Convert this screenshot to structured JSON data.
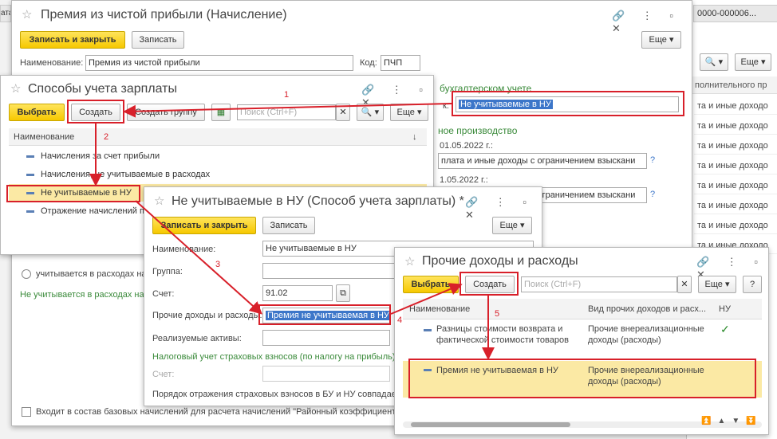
{
  "bg": {
    "tab_fragment": "ата",
    "tab_number": "0000-000006...",
    "search_btn": "🔍 ▾",
    "more_btn": "Еще ▾",
    "col_header": "полнительного пр",
    "rows": [
      "та и иные доходо",
      "та и иные доходо",
      "та и иные доходо",
      "та и иные доходо",
      "та и иные доходо",
      "та и иные доходо",
      "та и иные доходо",
      "та и иные доходо"
    ]
  },
  "main_form": {
    "title": "Премия из чистой прибыли (Начисление)",
    "save_close": "Записать и закрыть",
    "save": "Записать",
    "more": "Еще ▾",
    "name_label": "Наименование:",
    "name_value": "Премия из чистой прибыли",
    "code_label": "Код:",
    "code_value": "ПЧП",
    "accounting_heading": "бухгалтерском учете",
    "method_label": "к:",
    "method_value": "Не учитываемые в НУ",
    "production_heading": "ное производство",
    "date1": "01.05.2022 г.:",
    "payment1": "плата и иные доходы с ограничением взыскани",
    "date2": "1.05.2022 г.:",
    "payment2": "плата и иные доходы с ограничением взыскани",
    "help": "?",
    "radio1": "учитывается в расходах на",
    "link_text": "Не учитывается в расходах на",
    "checkbox_label": "Входит в состав базовых начислений для расчета начислений \"Районный коэффициент\" и"
  },
  "methods_list": {
    "title": "Способы учета зарплаты",
    "choose": "Выбрать",
    "create": "Создать",
    "create_group": "Создать группу",
    "search_placeholder": "Поиск (Ctrl+F)",
    "more": "Еще ▾",
    "col_name": "Наименование",
    "sort_icon": "↓",
    "items": [
      "Начисления за счет прибыли",
      "Начисления, не учитываемые в расходах",
      "Не учитываемые в НУ",
      "Отражение начислений п"
    ]
  },
  "method_form": {
    "title": "Не учитываемые в НУ (Способ учета зарплаты) *",
    "save_close": "Записать и закрыть",
    "save": "Записать",
    "more": "Еще ▾",
    "name_label": "Наименование:",
    "name_value": "Не учитываемые в НУ",
    "group_label": "Группа:",
    "account_label": "Счет:",
    "account_value": "91.02",
    "other_label": "Прочие доходы и расходы:",
    "other_value": "Премия не учитываемая в НУ",
    "assets_label": "Реализуемые активы:",
    "tax_heading": "Налоговый учет страховых взносов (по налогу на прибыль)",
    "tax_account_label": "Счет:",
    "order_text": "Порядок отражения страховых взносов в БУ и НУ совпадает"
  },
  "other_list": {
    "title": "Прочие доходы и расходы",
    "choose": "Выбрать",
    "create": "Создать",
    "search_placeholder": "Поиск (Ctrl+F)",
    "more": "Еще ▾",
    "help": "?",
    "columns": [
      "Наименование",
      "Вид прочих доходов и расх...",
      "НУ"
    ],
    "rows": [
      {
        "name1": "Разницы стоимости возврата и",
        "name2": "фактической стоимости товаров",
        "kind1": "Прочие внереализационные",
        "kind2": "доходы (расходы)",
        "nu": "✓"
      },
      {
        "name1": "Премия не учитываемая в НУ",
        "name2": "",
        "kind1": "Прочие внереализационные",
        "kind2": "доходы (расходы)",
        "nu": ""
      }
    ]
  },
  "steps": [
    "1",
    "2",
    "3",
    "4",
    "5"
  ]
}
